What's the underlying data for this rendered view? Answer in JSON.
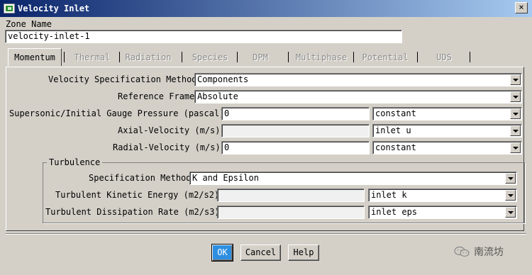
{
  "window": {
    "title": "Velocity Inlet",
    "close_label": "×"
  },
  "zone": {
    "label": "Zone Name",
    "value": "velocity-inlet-1"
  },
  "tabs": [
    {
      "label": "Momentum",
      "active": true
    },
    {
      "label": "Thermal",
      "active": false
    },
    {
      "label": "Radiation",
      "active": false
    },
    {
      "label": "Species",
      "active": false
    },
    {
      "label": "DPM",
      "active": false
    },
    {
      "label": "Multiphase",
      "active": false
    },
    {
      "label": "Potential",
      "active": false
    },
    {
      "label": "UDS",
      "active": false
    }
  ],
  "momentum": {
    "velocity_spec": {
      "label": "Velocity Specification Method",
      "value": "Components"
    },
    "reference_frame": {
      "label": "Reference Frame",
      "value": "Absolute"
    },
    "gauge_pressure": {
      "label": "Supersonic/Initial Gauge Pressure (pascal)",
      "value": "0",
      "method": "constant"
    },
    "axial_velocity": {
      "label": "Axial-Velocity (m/s)",
      "value": "",
      "method": "inlet u"
    },
    "radial_velocity": {
      "label": "Radial-Velocity (m/s)",
      "value": "0",
      "method": "constant"
    }
  },
  "turbulence": {
    "title": "Turbulence",
    "spec_method": {
      "label": "Specification Method",
      "value": "K and Epsilon"
    },
    "kinetic_energy": {
      "label": "Turbulent Kinetic Energy (m2/s2)",
      "value": "",
      "method": "inlet k"
    },
    "dissipation_rate": {
      "label": "Turbulent Dissipation Rate (m2/s3)",
      "value": "",
      "method": "inlet eps"
    }
  },
  "buttons": {
    "ok": "OK",
    "cancel": "Cancel",
    "help": "Help"
  },
  "watermark": {
    "text": "南流坊",
    "icon": "wechat-icon"
  },
  "colors": {
    "titlebar_start": "#0a246a",
    "titlebar_end": "#a6caf0",
    "face": "#d4d0c8",
    "ok_button": "#2e8fe0"
  }
}
